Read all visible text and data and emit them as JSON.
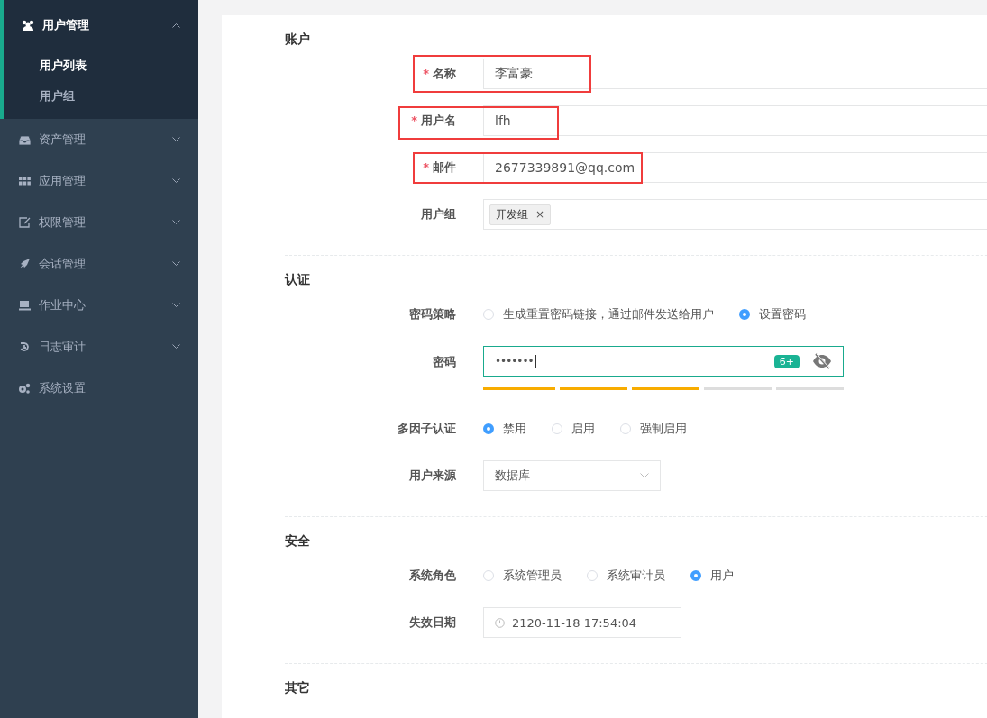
{
  "sidebar": {
    "items": [
      {
        "kind": "group",
        "label": "用户管理",
        "expanded": true,
        "children": [
          {
            "label": "用户列表",
            "selected": true
          },
          {
            "label": "用户组",
            "selected": false
          }
        ]
      },
      {
        "kind": "group",
        "label": "资产管理",
        "expanded": false
      },
      {
        "kind": "group",
        "label": "应用管理",
        "expanded": false
      },
      {
        "kind": "group",
        "label": "权限管理",
        "expanded": false
      },
      {
        "kind": "group",
        "label": "会话管理",
        "expanded": false
      },
      {
        "kind": "group",
        "label": "作业中心",
        "expanded": false
      },
      {
        "kind": "group",
        "label": "日志审计",
        "expanded": false
      },
      {
        "kind": "link",
        "label": "系统设置"
      }
    ]
  },
  "form": {
    "sections": [
      {
        "title": "账户",
        "fields": [
          {
            "kind": "text",
            "label": "名称",
            "required": true,
            "required_mark": "*",
            "highlighted": true,
            "value": "李富豪"
          },
          {
            "kind": "text",
            "label": "用户名",
            "required": true,
            "required_mark": "*",
            "highlighted": true,
            "value": "lfh"
          },
          {
            "kind": "text",
            "label": "邮件",
            "required": true,
            "required_mark": "*",
            "highlighted": true,
            "value": "2677339891@qq.com"
          },
          {
            "kind": "tags",
            "label": "用户组",
            "required": false,
            "highlighted": false,
            "tags": [
              {
                "label": "开发组",
                "remove": "×"
              }
            ]
          }
        ]
      },
      {
        "title": "认证",
        "fields": [
          {
            "kind": "radio",
            "label": "密码策略",
            "options": [
              {
                "label": "生成重置密码链接，通过邮件发送给用户",
                "selected": false
              },
              {
                "label": "设置密码",
                "selected": true
              }
            ]
          },
          {
            "kind": "password",
            "label": "密码",
            "value": "•••••••",
            "badge": "6+",
            "level": 0.6
          },
          {
            "kind": "radio",
            "label": "多因子认证",
            "options": [
              {
                "label": "禁用",
                "selected": true
              },
              {
                "label": "启用",
                "selected": false
              },
              {
                "label": "强制启用",
                "selected": false
              }
            ]
          },
          {
            "kind": "select",
            "label": "用户来源",
            "value": "数据库"
          }
        ]
      },
      {
        "title": "安全",
        "fields": [
          {
            "kind": "radio",
            "label": "系统角色",
            "options": [
              {
                "label": "系统管理员",
                "selected": false
              },
              {
                "label": "系统审计员",
                "selected": false
              },
              {
                "label": "用户",
                "selected": true
              }
            ]
          },
          {
            "kind": "datetime",
            "label": "失效日期",
            "value": "2120-11-18 17:54:04"
          }
        ]
      },
      {
        "title": "其它"
      }
    ]
  }
}
